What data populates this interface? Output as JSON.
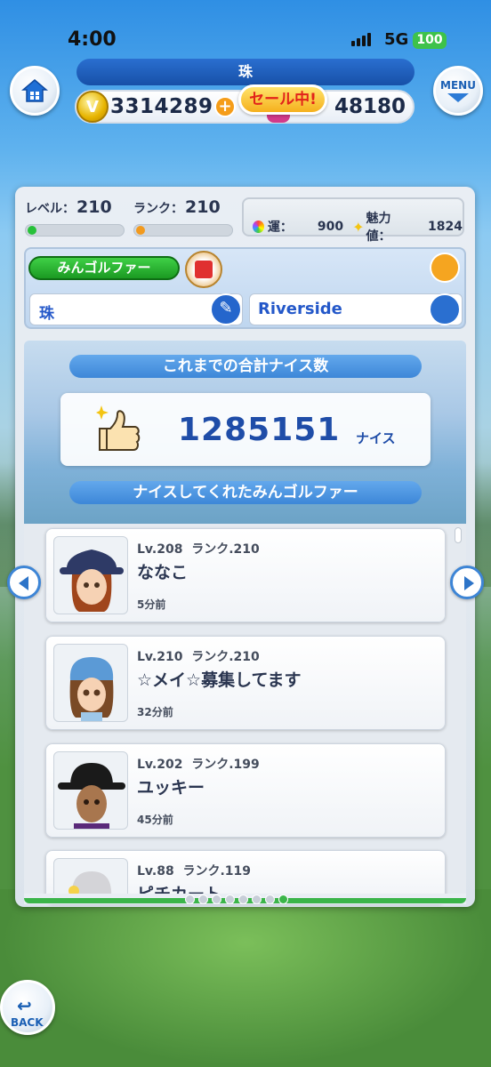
{
  "status_bar": {
    "time": "4:00",
    "network": "5G",
    "battery": "100"
  },
  "header": {
    "player_name": "珠",
    "coins": "3314289",
    "plus": "+",
    "sale_badge": "セール中!",
    "gems": "48180",
    "menu_label": "MENU"
  },
  "stats": {
    "level_label": "レベル：",
    "level": "210",
    "rank_label": "ランク：",
    "rank": "210",
    "luck_label": "運：",
    "luck": "900",
    "charm_label": "魅力値：",
    "charm": "1824"
  },
  "profile": {
    "title_badge": "みんゴルファー",
    "name": "珠",
    "club": "Riverside"
  },
  "nice": {
    "heading": "これまでの合計ナイス数",
    "total": "1285151",
    "unit": "ナイス",
    "list_heading": "ナイスしてくれたみんゴルファー"
  },
  "players": [
    {
      "lv": "Lv.208",
      "rank": "ランク.210",
      "name": "ななこ",
      "ago": "5分前"
    },
    {
      "lv": "Lv.210",
      "rank": "ランク.210",
      "name": "☆メイ☆募集してます",
      "ago": "32分前"
    },
    {
      "lv": "Lv.202",
      "rank": "ランク.199",
      "name": "ユッキー",
      "ago": "45分前"
    },
    {
      "lv": "Lv.88",
      "rank": "ランク.119",
      "name": "ピチカート",
      "ago": ""
    }
  ],
  "pagination": {
    "total": 7,
    "current": 7
  },
  "footer": {
    "back_label": "BACK"
  }
}
